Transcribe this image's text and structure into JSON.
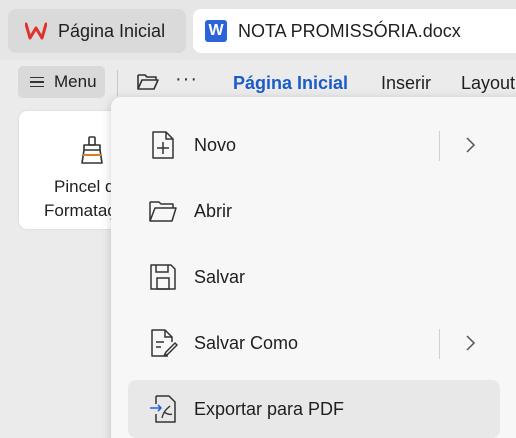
{
  "tabs": {
    "home": {
      "label": "Página Inicial",
      "icon": "wps-logo-icon"
    },
    "document": {
      "label": "NOTA PROMISSÓRIA.docx",
      "icon": "word-document-icon"
    }
  },
  "toolbar": {
    "menu_label": "Menu",
    "more_label": "···",
    "ribbon_tabs": [
      "Página Inicial",
      "Inserir",
      "Layout"
    ],
    "active_tab": "Página Inicial",
    "accent_color": "#1b5cc7"
  },
  "ribbon": {
    "format_painter": {
      "line1": "Pincel de",
      "line2": "Formatação"
    }
  },
  "file_menu": {
    "items": [
      {
        "label": "Novo",
        "icon": "new-file-icon",
        "has_submenu": true
      },
      {
        "label": "Abrir",
        "icon": "folder-open-icon",
        "has_submenu": false
      },
      {
        "label": "Salvar",
        "icon": "save-icon",
        "has_submenu": false
      },
      {
        "label": "Salvar Como",
        "icon": "save-as-icon",
        "has_submenu": true
      },
      {
        "label": "Exportar para PDF",
        "icon": "export-pdf-icon",
        "has_submenu": false
      }
    ]
  }
}
